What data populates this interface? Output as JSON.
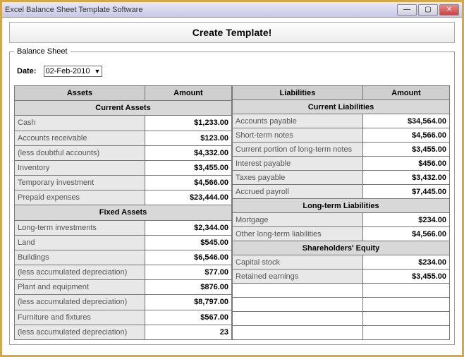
{
  "window": {
    "title": "Excel Balance Sheet Template Software"
  },
  "main_button": "Create Template!",
  "fieldset_title": "Balance Sheet",
  "date": {
    "label": "Date:",
    "value": "02-Feb-2010"
  },
  "headers": {
    "assets": "Assets",
    "amount": "Amount",
    "liabilities": "Liabilities"
  },
  "sections": {
    "current_assets": "Current Assets",
    "fixed_assets": "Fixed Assets",
    "current_liabilities": "Current Liabilities",
    "long_term_liabilities": "Long-term Liabilities",
    "shareholders_equity": "Shareholders' Equity"
  },
  "assets_current": [
    {
      "label": "Cash",
      "amount": "$1,233.00"
    },
    {
      "label": "Accounts receivable",
      "amount": "$123.00"
    },
    {
      "label": "(less doubtful accounts)",
      "amount": "$4,332.00"
    },
    {
      "label": "Inventory",
      "amount": "$3,455.00"
    },
    {
      "label": "Temporary investment",
      "amount": "$4,566.00"
    },
    {
      "label": "Prepaid expenses",
      "amount": "$23,444.00"
    }
  ],
  "assets_fixed": [
    {
      "label": "Long-term investments",
      "amount": "$2,344.00"
    },
    {
      "label": "Land",
      "amount": "$545.00"
    },
    {
      "label": "Buildings",
      "amount": "$6,546.00"
    },
    {
      "label": "(less accumulated depreciation)",
      "amount": "$77.00"
    },
    {
      "label": "Plant and equipment",
      "amount": "$876.00"
    },
    {
      "label": "(less accumulated depreciation)",
      "amount": "$8,797.00"
    },
    {
      "label": "Furniture and fixtures",
      "amount": "$567.00"
    },
    {
      "label": "(less accumulated depreciation)",
      "amount": "23"
    }
  ],
  "liab_current": [
    {
      "label": "Accounts payable",
      "amount": "$34,564.00"
    },
    {
      "label": "Short-term notes",
      "amount": "$4,566.00"
    },
    {
      "label": "Current portion of long-term notes",
      "amount": "$3,455.00"
    },
    {
      "label": "Interest payable",
      "amount": "$456.00"
    },
    {
      "label": "Taxes payable",
      "amount": "$3,432.00"
    },
    {
      "label": "Accrued payroll",
      "amount": "$7,445.00"
    }
  ],
  "liab_long": [
    {
      "label": "Mortgage",
      "amount": "$234.00"
    },
    {
      "label": "Other long-term liabilities",
      "amount": "$4,566.00"
    }
  ],
  "equity": [
    {
      "label": "Capital stock",
      "amount": "$234.00"
    },
    {
      "label": "Retained earnings",
      "amount": "$3,455.00"
    }
  ]
}
